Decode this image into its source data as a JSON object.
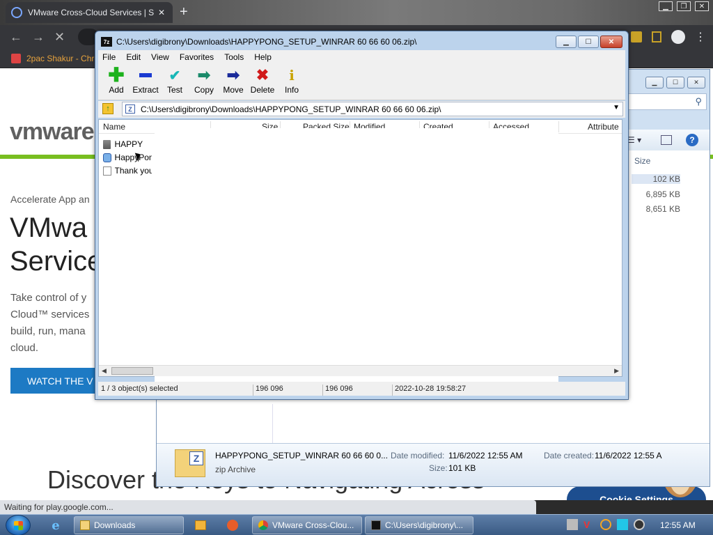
{
  "browser": {
    "tab_title": "VMware Cross-Cloud Services | S",
    "tab_close": "✕",
    "new_tab": "+",
    "bookmark": "2pac Shakur - Chro",
    "status_text": "Waiting for play.google.com...",
    "colors": {
      "frame": "#35363a",
      "accent": "#c9a227"
    }
  },
  "webpage": {
    "logo": "vmware",
    "eyebrow": "Accelerate App an",
    "headline_line1": "VMwa",
    "headline_line2": "Service",
    "body_lines": [
      "Take control of y",
      "Cloud™ services",
      "build, run, mana",
      "cloud."
    ],
    "cta": "WATCH THE V",
    "discover": "Discover the Keys to Navigating Across",
    "cookie_button": "Cookie Settings",
    "colors": {
      "brand_green": "#78be20",
      "cta_blue": "#1d7ac4",
      "cookie_blue": "#1d4e8f"
    }
  },
  "explorer": {
    "column_size": "Size",
    "sizes": [
      "102 KB",
      "6,895 KB",
      "8,651 KB"
    ],
    "details": {
      "filename": "HAPPYPONG_SETUP_WINRAR 60 66 60 0...",
      "filetype": "zip Archive",
      "modified_label": "Date modified:",
      "modified_value": "11/6/2022 12:55 AM",
      "created_label": "Date created:",
      "created_value": "11/6/2022 12:55 A",
      "size_label": "Size:",
      "size_value": "101 KB"
    }
  },
  "sevenzip": {
    "title": "C:\\Users\\digibrony\\Downloads\\HAPPYPONG_SETUP_WINRAR 60 66 60 06.zip\\",
    "app_icon": "7z",
    "menu": [
      "File",
      "Edit",
      "View",
      "Favorites",
      "Tools",
      "Help"
    ],
    "toolbar": {
      "add": "Add",
      "extract": "Extract",
      "test": "Test",
      "copy": "Copy",
      "move": "Move",
      "delete": "Delete",
      "info": "Info"
    },
    "address": "C:\\Users\\digibrony\\Downloads\\HAPPYPONG_SETUP_WINRAR 60 66 60 06.zip\\",
    "columns": {
      "name": "Name",
      "size": "Size",
      "packed_size": "Packed Size",
      "modified": "Modified",
      "created": "Created",
      "accessed": "Accessed",
      "attributes": "Attribute"
    },
    "rows": [
      {
        "name": "HAPPY",
        "icon": "folder-icon"
      },
      {
        "name": "HappyPon",
        "icon": "setup-icon"
      },
      {
        "name": "Thank you",
        "icon": "text-file-icon"
      }
    ],
    "status": {
      "selection": "1 / 3 object(s) selected",
      "size": "196 096",
      "packed": "196 096",
      "date": "2022-10-28 19:58:27"
    }
  },
  "taskbar": {
    "tasks": [
      "Downloads",
      "VMware Cross-Clou...",
      "C:\\Users\\digibrony\\..."
    ],
    "clock": "12:55 AM"
  }
}
